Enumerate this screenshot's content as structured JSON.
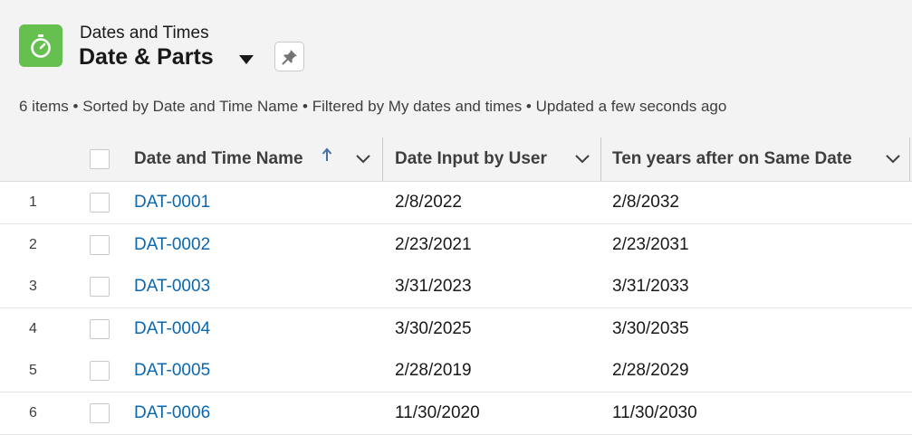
{
  "header": {
    "object_label": "Dates and Times",
    "list_title": "Date & Parts",
    "meta_text": "6 items • Sorted by Date and Time Name • Filtered by My dates and times • Updated a few seconds ago",
    "app_icon": "stopwatch-icon",
    "pin_icon": "pin-icon"
  },
  "columns": [
    {
      "label": "Date and Time Name",
      "sorted": "ascending"
    },
    {
      "label": "Date Input by User"
    },
    {
      "label": "Ten years after on Same Date"
    }
  ],
  "rows": [
    {
      "num": "1",
      "name": "DAT-0001",
      "date": "2/8/2022",
      "ten": "2/8/2032"
    },
    {
      "num": "2",
      "name": "DAT-0002",
      "date": "2/23/2021",
      "ten": "2/23/2031"
    },
    {
      "num": "3",
      "name": "DAT-0003",
      "date": "3/31/2023",
      "ten": "3/31/2033"
    },
    {
      "num": "4",
      "name": "DAT-0004",
      "date": "3/30/2025",
      "ten": "3/30/2035"
    },
    {
      "num": "5",
      "name": "DAT-0005",
      "date": "2/28/2019",
      "ten": "2/28/2029"
    },
    {
      "num": "6",
      "name": "DAT-0006",
      "date": "11/30/2020",
      "ten": "11/30/2030"
    }
  ],
  "colors": {
    "app_icon_bg": "#65c04f",
    "link": "#0b67b0",
    "sort_arrow": "#4a6fa5"
  }
}
